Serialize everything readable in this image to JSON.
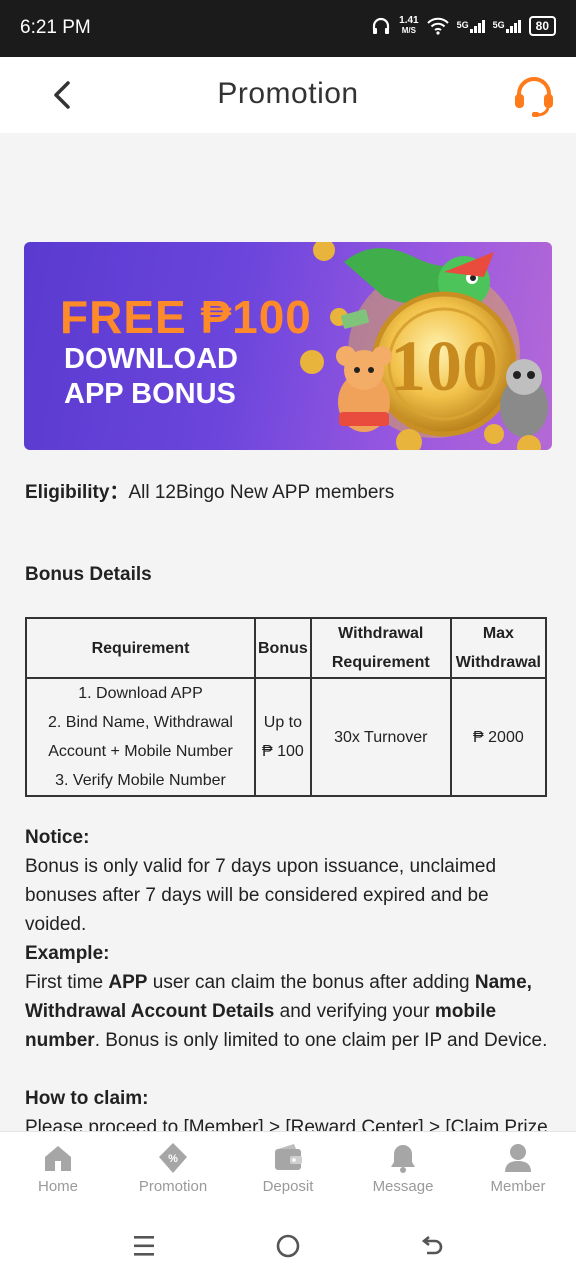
{
  "status_bar": {
    "time": "6:21 PM",
    "speed_value": "1.41",
    "speed_unit": "M/S",
    "net1": "5G",
    "net2": "5G",
    "battery": "80"
  },
  "header": {
    "title": "Promotion",
    "back_icon": "chevron-left-icon",
    "support_icon": "headset-icon",
    "accent_color": "#ff7a1a"
  },
  "banner": {
    "line1": "FREE ₱100",
    "line2": "DOWNLOAD",
    "line3": "APP BONUS",
    "coin_text": "100"
  },
  "eligibility": {
    "label": "Eligibility：",
    "value": "All 12Bingo New APP members"
  },
  "bonus_details": {
    "heading": "Bonus Details",
    "headers": {
      "requirement": "Requirement",
      "bonus": "Bonus",
      "withdrawal_req_1": "Withdrawal",
      "withdrawal_req_2": "Requirement",
      "max_withdrawal_1": "Max",
      "max_withdrawal_2": "Withdrawal"
    },
    "row": {
      "req1": "1. Download APP",
      "req2": "2. Bind Name, Withdrawal",
      "req3": "Account + Mobile Number",
      "req4": "3. Verify Mobile Number",
      "bonus1": "Up to",
      "bonus2": "₱ 100",
      "withdrawal_requirement": "30x Turnover",
      "max_withdrawal": "₱ 2000"
    }
  },
  "notice": {
    "heading": "Notice:",
    "body": "Bonus is only valid for 7 days upon issuance, unclaimed bonuses after 7 days will be considered expired and be voided."
  },
  "example": {
    "heading": "Example:",
    "t1": "First time ",
    "b1": "APP",
    "t2": " user can claim the bonus after adding ",
    "b2": "Name, Withdrawal Account Details",
    "t3": " and verifying your ",
    "b3": "mobile number",
    "t4": ". Bonus is only limited to one claim per IP and Device."
  },
  "how_to_claim": {
    "heading": "How to claim:",
    "body": "Please proceed to [Member] > [Reward Center] > [Claim Prize"
  },
  "bottom_nav": {
    "items": [
      {
        "label": "Home",
        "icon": "home-icon"
      },
      {
        "label": "Promotion",
        "icon": "promotion-icon"
      },
      {
        "label": "Deposit",
        "icon": "wallet-icon"
      },
      {
        "label": "Message",
        "icon": "bell-icon"
      },
      {
        "label": "Member",
        "icon": "user-icon"
      }
    ]
  },
  "system_nav": {
    "menu_icon": "menu-icon",
    "home_icon": "circle-home-icon",
    "back_icon": "back-arrow-icon"
  }
}
